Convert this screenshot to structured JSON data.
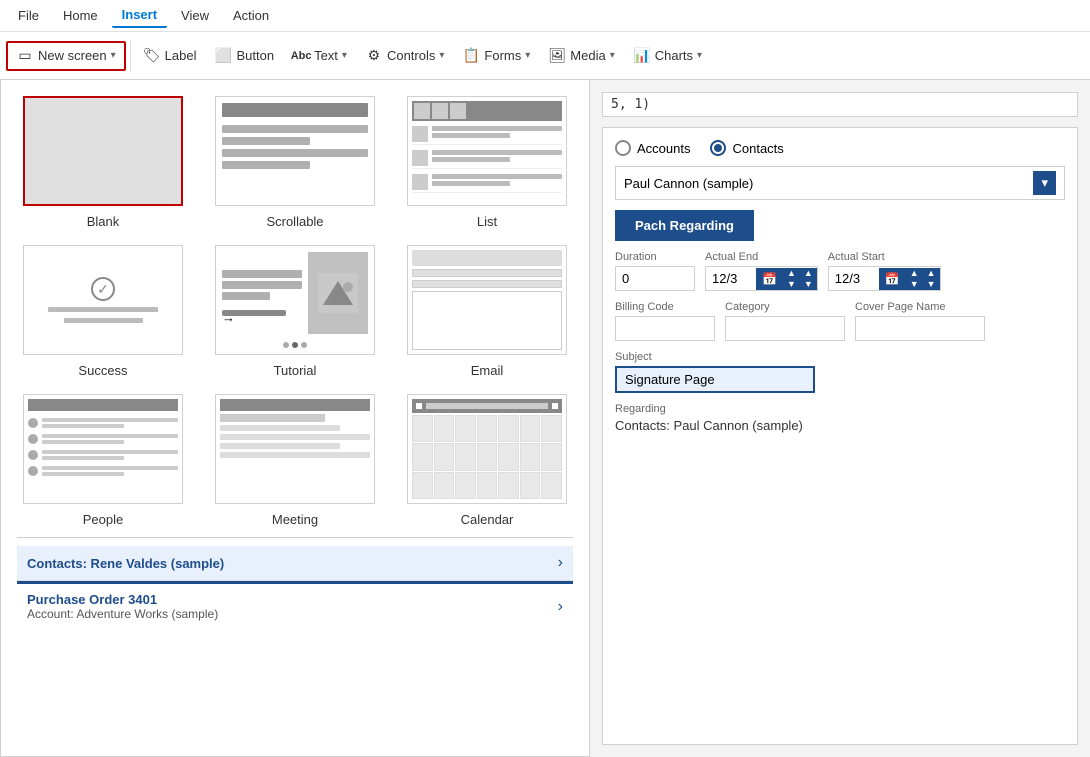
{
  "menubar": {
    "items": [
      {
        "id": "file",
        "label": "File",
        "active": false
      },
      {
        "id": "home",
        "label": "Home",
        "active": false
      },
      {
        "id": "insert",
        "label": "Insert",
        "active": true
      },
      {
        "id": "view",
        "label": "View",
        "active": false
      },
      {
        "id": "action",
        "label": "Action",
        "active": false
      }
    ]
  },
  "ribbon": {
    "newscreen": {
      "label": "New screen",
      "icon": "▭"
    },
    "label": {
      "label": "Label",
      "icon": "🏷"
    },
    "button": {
      "label": "Button",
      "icon": "⬜"
    },
    "text": {
      "label": "Text",
      "icon": "Abc"
    },
    "controls": {
      "label": "Controls",
      "icon": "⚙"
    },
    "forms": {
      "label": "Forms",
      "icon": "📋"
    },
    "media": {
      "label": "Media",
      "icon": "🖼"
    },
    "charts": {
      "label": "Charts",
      "icon": "📊"
    }
  },
  "screenTypes": [
    {
      "id": "blank",
      "label": "Blank",
      "selected": true
    },
    {
      "id": "scrollable",
      "label": "Scrollable",
      "selected": false
    },
    {
      "id": "list",
      "label": "List",
      "selected": false
    },
    {
      "id": "success",
      "label": "Success",
      "selected": false
    },
    {
      "id": "tutorial",
      "label": "Tutorial",
      "selected": false
    },
    {
      "id": "email",
      "label": "Email",
      "selected": false
    },
    {
      "id": "people",
      "label": "People",
      "selected": false
    },
    {
      "id": "meeting",
      "label": "Meeting",
      "selected": false
    },
    {
      "id": "calendar",
      "label": "Calendar",
      "selected": false
    }
  ],
  "formula": {
    "text": "5, 1)"
  },
  "radioGroup": {
    "options": [
      {
        "id": "accounts",
        "label": "Accounts",
        "checked": false
      },
      {
        "id": "contacts",
        "label": "Contacts",
        "checked": true
      }
    ]
  },
  "dropdown": {
    "selected": "Paul Cannon (sample)"
  },
  "patchButton": {
    "label": "Pach Regarding"
  },
  "fields": {
    "duration": {
      "label": "Duration",
      "value": "0"
    },
    "actualEnd": {
      "label": "Actual End",
      "value": "12/3"
    },
    "actualStart": {
      "label": "Actual Start",
      "value": "12/3"
    },
    "billingCode": {
      "label": "Billing Code",
      "value": ""
    },
    "category": {
      "label": "Category",
      "value": ""
    },
    "coverPageName": {
      "label": "Cover Page Name",
      "value": ""
    },
    "subject": {
      "label": "Subject",
      "value": "Signature Page"
    },
    "regarding": {
      "label": "Regarding",
      "text": "Contacts: Paul Cannon (sample)"
    }
  },
  "listItems": [
    {
      "id": "item1",
      "title": "Contacts: Rene Valdes (sample)",
      "subtitle": "",
      "hasChevron": true,
      "hasBorderTop": false
    },
    {
      "id": "item2",
      "title": "Purchase Order 3401",
      "subtitle": "Account: Adventure Works (sample)",
      "hasChevron": true,
      "hasBorderTop": true
    }
  ]
}
